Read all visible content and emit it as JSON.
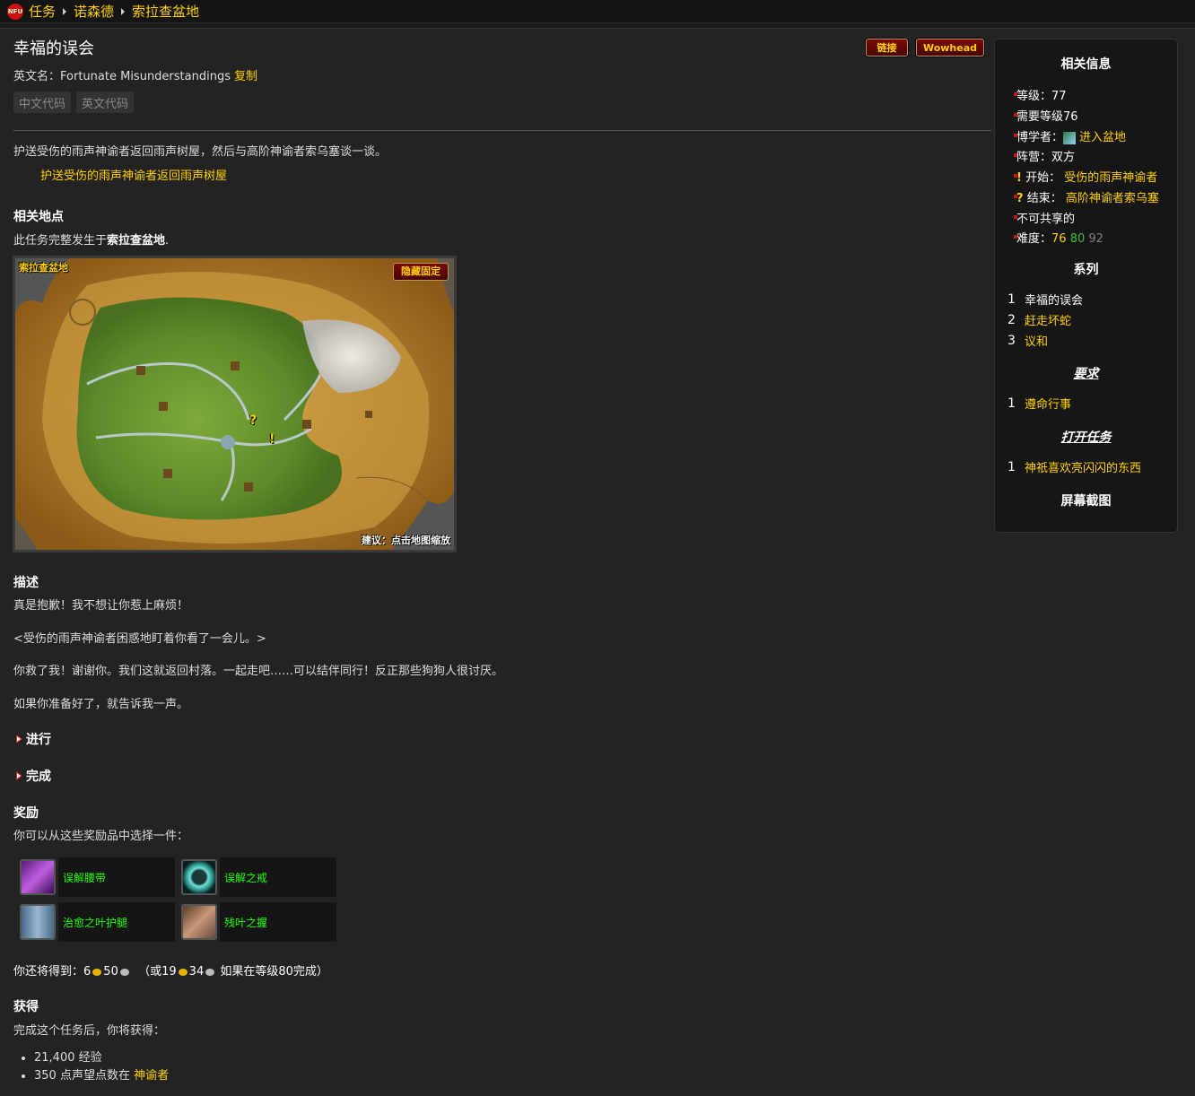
{
  "breadcrumb": {
    "logo_text": "NFU",
    "items": [
      "任务",
      "诺森德",
      "索拉查盆地"
    ]
  },
  "quest": {
    "title": "幸福的误会",
    "english_name_label": "英文名：",
    "english_name": "Fortunate Misunderstandings",
    "copy_label": "复制",
    "code_buttons": [
      "中文代码",
      "英文代码"
    ],
    "link_button": "链接",
    "wowhead_button": "Wowhead",
    "objective": "护送受伤的雨声神谕者返回雨声树屋，然后与高阶神谕者索乌塞谈一谈。",
    "objective_item": "护送受伤的雨声神谕者返回雨声树屋"
  },
  "location": {
    "heading": "相关地点",
    "text_prefix": "此任务完整发生于",
    "zone": "索拉查盆地",
    "text_suffix": ".",
    "map_label": "索拉查盆地",
    "hide_pin": "隐藏固定",
    "hint": "建议：点击地图缩放",
    "markers": [
      "?",
      "!"
    ]
  },
  "description": {
    "heading": "描述",
    "paragraphs": [
      "真是抱歉！我不想让你惹上麻烦！",
      "<受伤的雨声神谕者困惑地盯着你看了一会儿。>",
      "你救了我！谢谢你。我们这就返回村落。一起走吧……可以结伴同行！反正那些狗狗人很讨厌。",
      "如果你准备好了，就告诉我一声。"
    ]
  },
  "sections": {
    "progress": "进行",
    "complete": "完成"
  },
  "rewards": {
    "heading": "奖励",
    "choose_text": "你可以从这些奖励品中选择一件：",
    "items": [
      {
        "name": "误解腰带",
        "icon": "belt-icon"
      },
      {
        "name": "误解之戒",
        "icon": "ring-icon"
      },
      {
        "name": "治愈之叶护腿",
        "icon": "leggings-icon"
      },
      {
        "name": "残叶之握",
        "icon": "gloves-icon"
      }
    ],
    "money_prefix": "你还将得到：",
    "gold": "6",
    "silver": "50",
    "alt_prefix": "（或",
    "alt_gold": "19",
    "alt_silver": "34",
    "alt_suffix": "如果在等级80完成）"
  },
  "gains": {
    "heading": "获得",
    "text": "完成这个任务后，你将获得：",
    "xp": "21,400 经验",
    "rep_prefix": "350 点声望点数在",
    "rep_faction": "神谕者"
  },
  "sidebar": {
    "heading": "相关信息",
    "level": "等级：77",
    "req_level": "需要等级76",
    "loremaster_label": "博学者：",
    "loremaster_value": "进入盆地",
    "faction": "阵营：双方",
    "start_label": "开始：",
    "start_value": "受伤的雨声神谕者",
    "end_label": "结束：",
    "end_value": "高阶神谕者索乌塞",
    "not_shareable": "不可共享的",
    "difficulty_label": "难度：",
    "difficulty": [
      "76",
      "80",
      "92"
    ],
    "series_heading": "系列",
    "series": [
      {
        "num": "1",
        "name": "幸福的误会"
      },
      {
        "num": "2",
        "name": "赶走坏蛇"
      },
      {
        "num": "3",
        "name": "议和"
      }
    ],
    "requires_heading": "要求",
    "requires": [
      {
        "num": "1",
        "name": "遵命行事"
      }
    ],
    "opens_heading": "打开任务",
    "opens": [
      {
        "num": "1",
        "name": "神祇喜欢亮闪闪的东西"
      }
    ],
    "screenshots_heading": "屏幕截图"
  },
  "colors": {
    "quest_yellow": "#ffd100",
    "uncommon_green": "#1eff00",
    "difficulty_yellow": "#ffd100",
    "difficulty_green": "#40bf40",
    "difficulty_grey": "#808080"
  }
}
